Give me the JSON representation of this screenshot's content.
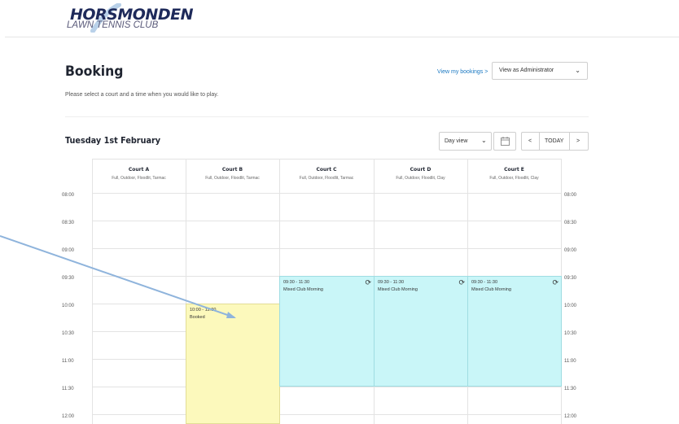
{
  "header": {
    "logo_main": "HORSMONDEN",
    "logo_sub": "LAWN TENNIS CLUB"
  },
  "page": {
    "title": "Booking",
    "description": "Please select a court and a time when you would like to play.",
    "my_bookings_link": "View my bookings >",
    "view_as_select": "View as Administrator"
  },
  "calendar": {
    "date_title": "Tuesday 1st February",
    "view_select": "Day view",
    "today_label": "TODAY",
    "prev_label": "<",
    "next_label": ">",
    "courts": [
      {
        "name": "Court A",
        "desc": "Full, Outdoor, Floodlit, Tarmac"
      },
      {
        "name": "Court B",
        "desc": "Full, Outdoor, Floodlit, Tarmac"
      },
      {
        "name": "Court C",
        "desc": "Full, Outdoor, Floodlit, Tarmac"
      },
      {
        "name": "Court D",
        "desc": "Full, Outdoor, Floodlit, Clay"
      },
      {
        "name": "Court E",
        "desc": "Full, Outdoor, Floodlit, Clay"
      }
    ],
    "times": [
      "08:00",
      "08:30",
      "09:00",
      "09:30",
      "10:00",
      "10:30",
      "11:00",
      "11:30",
      "12:00"
    ],
    "events": [
      {
        "court": 1,
        "time": "10:00 - 12:00",
        "name": "Booked",
        "type": "booked",
        "recurring": false
      },
      {
        "court": 2,
        "time": "09:30 - 11:30",
        "name": "Mixed Club Morning",
        "type": "club",
        "recurring": true
      },
      {
        "court": 3,
        "time": "09:30 - 11:30",
        "name": "Mixed Club Morning",
        "type": "club",
        "recurring": true
      },
      {
        "court": 4,
        "time": "09:30 - 11:30",
        "name": "Mixed Club Morning",
        "type": "club",
        "recurring": true
      }
    ],
    "colors": {
      "booked": "#fcf9bc",
      "club": "#c9f6f8"
    },
    "icons": {
      "recurring": "refresh-icon",
      "calendar": "calendar-icon",
      "dropdown": "chevron-down-icon"
    }
  }
}
